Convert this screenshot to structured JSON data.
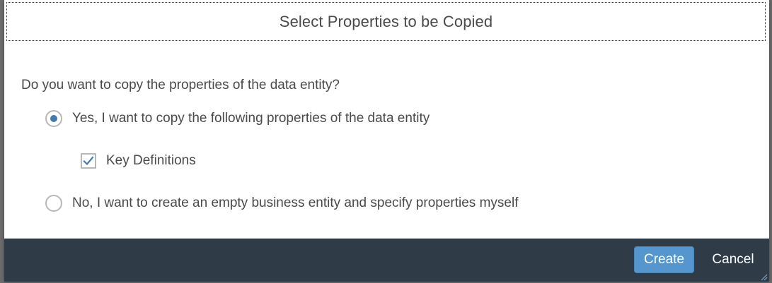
{
  "dialog": {
    "title": "Select Properties to be Copied",
    "question": "Do you want to copy the properties of the data entity?",
    "options": [
      {
        "label": "Yes, I want to copy the following properties of the data entity",
        "selected": true
      },
      {
        "label": "No, I want to create an empty business entity and specify properties myself",
        "selected": false
      }
    ],
    "properties": [
      {
        "label": "Key Definitions",
        "checked": true
      }
    ],
    "buttons": {
      "create_label": "Create",
      "cancel_label": "Cancel"
    }
  },
  "colors": {
    "accent": "#427cac",
    "footer": "#2f3c48",
    "primary_button": "#5496cd"
  },
  "icons": {
    "radio_selected": "radio-selected-icon",
    "radio_unselected": "radio-unselected-icon",
    "checkbox_checked": "checkmark-icon",
    "resize": "resize-grip-icon"
  }
}
